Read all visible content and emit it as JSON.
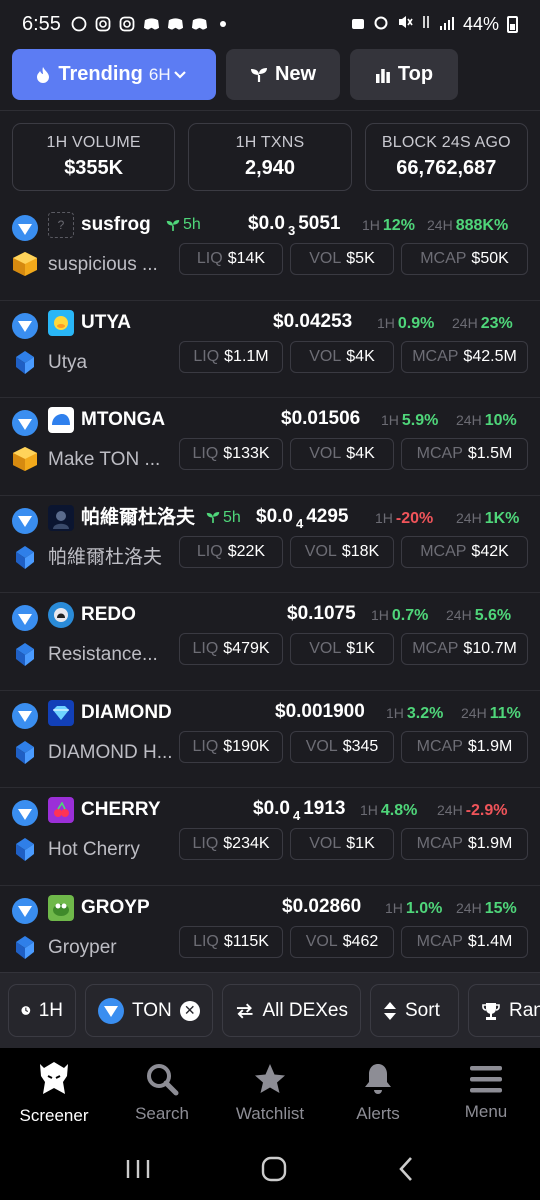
{
  "status_bar": {
    "time": "6:55",
    "battery": "44%"
  },
  "tabs": [
    {
      "label": "Trending",
      "sub": "6H"
    },
    {
      "label": "New"
    },
    {
      "label": "Top"
    }
  ],
  "stats": [
    {
      "label": "1H VOLUME",
      "value": "$355K"
    },
    {
      "label": "1H TXNS",
      "value": "2,940"
    },
    {
      "label": "BLOCK 24S AGO",
      "value": "66,762,687"
    }
  ],
  "labels": {
    "h1": "1H",
    "h24": "24H",
    "liq": "LIQ",
    "vol": "VOL",
    "mcap": "MCAP"
  },
  "tokens": [
    {
      "symbol": "susfrog",
      "age": "5h",
      "price_pre": "$0.0",
      "price_sub": "3",
      "price_post": "5051",
      "change_1h": "12%",
      "change_24h": "888K%",
      "name": "suspicious ...",
      "liq": "$14K",
      "vol": "$5K",
      "mcap": "$50K"
    },
    {
      "symbol": "UTYA",
      "price_pre": "$0.04253",
      "change_1h": "0.9%",
      "change_24h": "23%",
      "name": "Utya",
      "liq": "$1.1M",
      "vol": "$4K",
      "mcap": "$42.5M"
    },
    {
      "symbol": "MTONGA",
      "price_pre": "$0.01506",
      "change_1h": "5.9%",
      "change_24h": "10%",
      "name": "Make TON ...",
      "liq": "$133K",
      "vol": "$4K",
      "mcap": "$1.5M"
    },
    {
      "symbol": "帕維爾杜洛夫",
      "age": "5h",
      "price_pre": "$0.0",
      "price_sub": "4",
      "price_post": "4295",
      "change_1h": "-20%",
      "change_24h": "1K%",
      "name": "帕維爾杜洛夫",
      "liq": "$22K",
      "vol": "$18K",
      "mcap": "$42K"
    },
    {
      "symbol": "REDO",
      "price_pre": "$0.1075",
      "change_1h": "0.7%",
      "change_24h": "5.6%",
      "name": "Resistance...",
      "liq": "$479K",
      "vol": "$1K",
      "mcap": "$10.7M"
    },
    {
      "symbol": "DIAMOND",
      "price_pre": "$0.001900",
      "change_1h": "3.2%",
      "change_24h": "11%",
      "name": "DIAMOND H...",
      "liq": "$190K",
      "vol": "$345",
      "mcap": "$1.9M"
    },
    {
      "symbol": "CHERRY",
      "price_pre": "$0.0",
      "price_sub": "4",
      "price_post": "1913",
      "change_1h": "4.8%",
      "change_24h": "-2.9%",
      "name": "Hot Cherry",
      "liq": "$234K",
      "vol": "$1K",
      "mcap": "$1.9M"
    },
    {
      "symbol": "GROYP",
      "price_pre": "$0.02860",
      "change_1h": "1.0%",
      "change_24h": "15%",
      "name": "Groyper",
      "liq": "$115K",
      "vol": "$462",
      "mcap": "$1.4M"
    }
  ],
  "filters": {
    "timeframe": "1H",
    "chain": "TON",
    "dexes": "All DEXes",
    "sort": "Sort",
    "rank": "Ran"
  },
  "bottom_nav": [
    "Screener",
    "Search",
    "Watchlist",
    "Alerts",
    "Menu"
  ],
  "colors": {
    "accent": "#5c7cf3",
    "positive": "#4fd67a",
    "negative": "#f0545a",
    "ton_blue": "#3a8ef0"
  }
}
